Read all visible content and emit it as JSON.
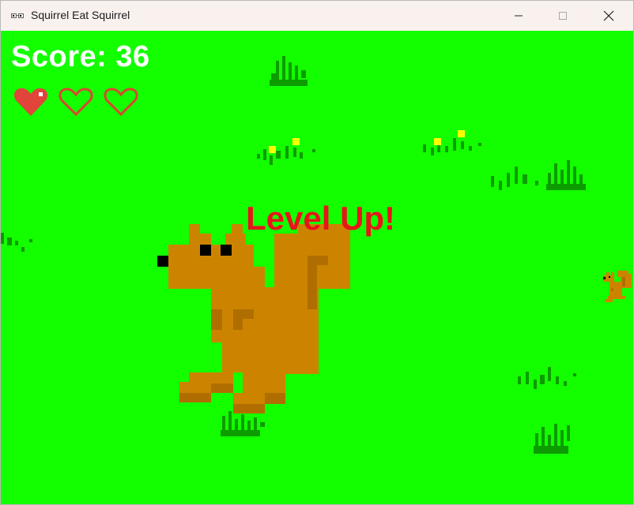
{
  "window": {
    "title": "Squirrel Eat Squirrel",
    "app_icon": "squirrel-icon",
    "controls": [
      "minimize-icon",
      "maximize-icon",
      "close-icon"
    ]
  },
  "game": {
    "background_color": "#13ff00",
    "score_label": "Score: 36",
    "score": 36,
    "health": {
      "max": 3,
      "current": 1,
      "full_color": "#e0443a"
    },
    "message": "Level Up!",
    "message_color": "#e8141a",
    "player": {
      "color": "#cc8400",
      "shade": "#b06e00"
    },
    "enemy_squirrels": 1,
    "grass_patches": 9
  }
}
